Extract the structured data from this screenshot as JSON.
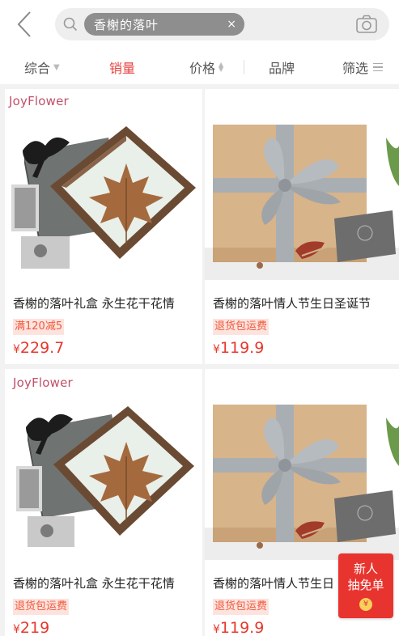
{
  "search": {
    "chip_text": "香榭的落叶",
    "chip_close": "×"
  },
  "sort_bar": {
    "items": [
      {
        "label": "综合"
      },
      {
        "label": "销量"
      },
      {
        "label": "价格"
      },
      {
        "label": "品牌"
      },
      {
        "label": "筛选"
      }
    ],
    "active": "销量"
  },
  "products": [
    {
      "brand": "JoyFlower",
      "title": "香榭的落叶礼盒 永生花干花情",
      "tag": "满120减5",
      "currency": "¥",
      "price": "229.7",
      "image": "maple-leaf-glass-box"
    },
    {
      "brand": "",
      "title": "香榭的落叶情人节生日圣诞节",
      "tag": "退货包运费",
      "currency": "¥",
      "price": "119.9",
      "image": "kraft-gift-box-silver-ribbon"
    },
    {
      "brand": "JoyFlower",
      "title": "香榭的落叶礼盒 永生花干花情",
      "tag": "退货包运费",
      "currency": "¥",
      "price": "219",
      "image": "maple-leaf-glass-box"
    },
    {
      "brand": "",
      "title": "香榭的落叶情人节生日",
      "tag": "退货包运费",
      "currency": "¥",
      "price": "119.9",
      "image": "kraft-gift-box-silver-ribbon"
    }
  ],
  "float_badge": {
    "line1": "新人",
    "line2": "抽免单",
    "coin": "¥"
  },
  "colors": {
    "accent": "#e64340",
    "price": "#e6392e",
    "tag_bg": "#fde3de",
    "tag_text": "#f05a3c",
    "brand_logo": "#c0506a"
  }
}
